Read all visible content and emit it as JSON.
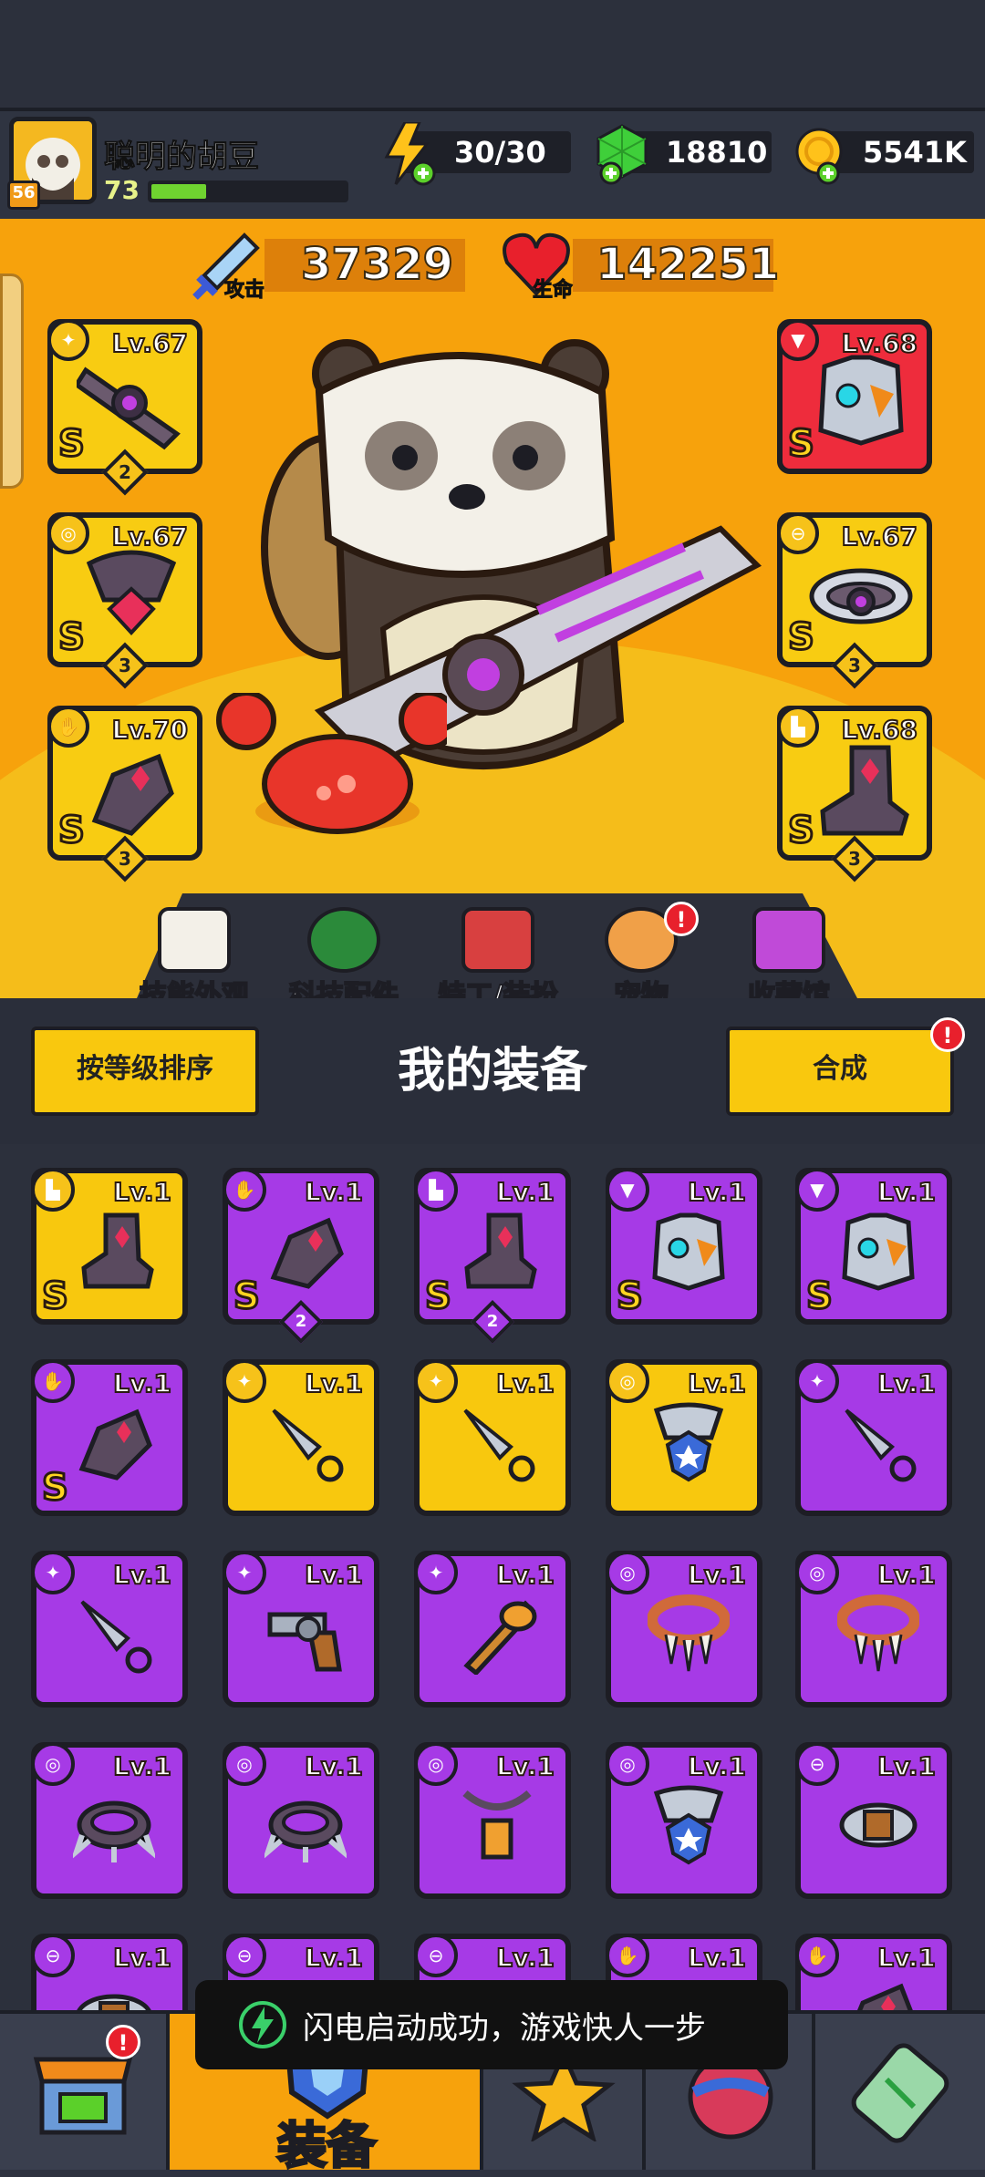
{
  "player": {
    "name": "聪明的胡豆",
    "level": "73",
    "vip": "56"
  },
  "resources": {
    "energy": "30/30",
    "gems": "18810",
    "coins": "5541K"
  },
  "stats": {
    "attack_label": "攻击",
    "attack_value": "37329",
    "hp_label": "生命",
    "hp_value": "142251"
  },
  "equipped": [
    {
      "lv": "Lv.67",
      "grade": "S",
      "count": "2",
      "icon": "dagger-icon"
    },
    {
      "lv": "Lv.67",
      "grade": "S",
      "count": "3",
      "icon": "necklace-icon"
    },
    {
      "lv": "Lv.70",
      "grade": "S",
      "count": "3",
      "icon": "glove-icon"
    },
    {
      "lv": "Lv.68",
      "grade": "S",
      "count": "",
      "icon": "armor-icon"
    },
    {
      "lv": "Lv.67",
      "grade": "S",
      "count": "3",
      "icon": "belt-icon"
    },
    {
      "lv": "Lv.68",
      "grade": "S",
      "count": "3",
      "icon": "boot-icon"
    }
  ],
  "menu": {
    "skill_skin": "技能外观",
    "tech_parts": "科技配件",
    "agent_outfit": "特工/装扮",
    "pet": "宠物",
    "collection": "收藏馆"
  },
  "equipment_panel": {
    "sort_button": "按等级排序",
    "title": "我的装备",
    "merge_button": "合成"
  },
  "inventory": [
    {
      "lv": "Lv.1",
      "color": "yellow",
      "grade": "S",
      "count": "",
      "icon": "boot-icon"
    },
    {
      "lv": "Lv.1",
      "color": "purple",
      "grade": "S",
      "count": "2",
      "icon": "glove-icon"
    },
    {
      "lv": "Lv.1",
      "color": "purple",
      "grade": "S",
      "count": "2",
      "icon": "boot-icon"
    },
    {
      "lv": "Lv.1",
      "color": "purple",
      "grade": "S",
      "count": "",
      "icon": "armor-icon"
    },
    {
      "lv": "Lv.1",
      "color": "purple",
      "grade": "S",
      "count": "",
      "icon": "armor-icon"
    },
    {
      "lv": "Lv.1",
      "color": "purple",
      "grade": "S",
      "count": "",
      "icon": "glove-icon"
    },
    {
      "lv": "Lv.1",
      "color": "yellow",
      "grade": "",
      "count": "",
      "icon": "kunai-icon"
    },
    {
      "lv": "Lv.1",
      "color": "yellow",
      "grade": "",
      "count": "",
      "icon": "kunai-icon"
    },
    {
      "lv": "Lv.1",
      "color": "yellow",
      "grade": "",
      "count": "",
      "icon": "necklace-icon"
    },
    {
      "lv": "Lv.1",
      "color": "purple",
      "grade": "",
      "count": "",
      "icon": "kunai-icon"
    },
    {
      "lv": "Lv.1",
      "color": "purple",
      "grade": "",
      "count": "",
      "icon": "kunai-icon"
    },
    {
      "lv": "Lv.1",
      "color": "purple",
      "grade": "",
      "count": "",
      "icon": "revolver-icon"
    },
    {
      "lv": "Lv.1",
      "color": "purple",
      "grade": "",
      "count": "",
      "icon": "bat-icon"
    },
    {
      "lv": "Lv.1",
      "color": "purple",
      "grade": "",
      "count": "",
      "icon": "fang-necklace-icon"
    },
    {
      "lv": "Lv.1",
      "color": "purple",
      "grade": "",
      "count": "",
      "icon": "fang-necklace-icon"
    },
    {
      "lv": "Lv.1",
      "color": "purple",
      "grade": "",
      "count": "",
      "icon": "spiked-collar-icon"
    },
    {
      "lv": "Lv.1",
      "color": "purple",
      "grade": "",
      "count": "",
      "icon": "spiked-collar-icon"
    },
    {
      "lv": "Lv.1",
      "color": "purple",
      "grade": "",
      "count": "",
      "icon": "lantern-necklace-icon"
    },
    {
      "lv": "Lv.1",
      "color": "purple",
      "grade": "",
      "count": "",
      "icon": "necklace-icon"
    },
    {
      "lv": "Lv.1",
      "color": "purple",
      "grade": "",
      "count": "",
      "icon": "belt-icon"
    },
    {
      "lv": "Lv.1",
      "color": "purple",
      "grade": "",
      "count": "",
      "icon": "belt-icon"
    },
    {
      "lv": "Lv.1",
      "color": "purple",
      "grade": "",
      "count": "",
      "icon": "belt-icon"
    },
    {
      "lv": "Lv.1",
      "color": "purple",
      "grade": "",
      "count": "",
      "icon": "belt-icon"
    },
    {
      "lv": "Lv.1",
      "color": "purple",
      "grade": "",
      "count": "",
      "icon": "glove-icon"
    },
    {
      "lv": "Lv.1",
      "color": "purple",
      "grade": "",
      "count": "",
      "icon": "glove-icon"
    }
  ],
  "bottom_nav": {
    "equipment_label": "装备"
  },
  "toast": {
    "text": "闪电启动成功，游戏快人一步"
  },
  "colors": {
    "hero_bg": "#f7a20c",
    "purple_rarity": "#a63ae6",
    "yellow_rarity": "#f8c80e",
    "red_rarity": "#ee2c3c",
    "alert": "#e8202c"
  }
}
